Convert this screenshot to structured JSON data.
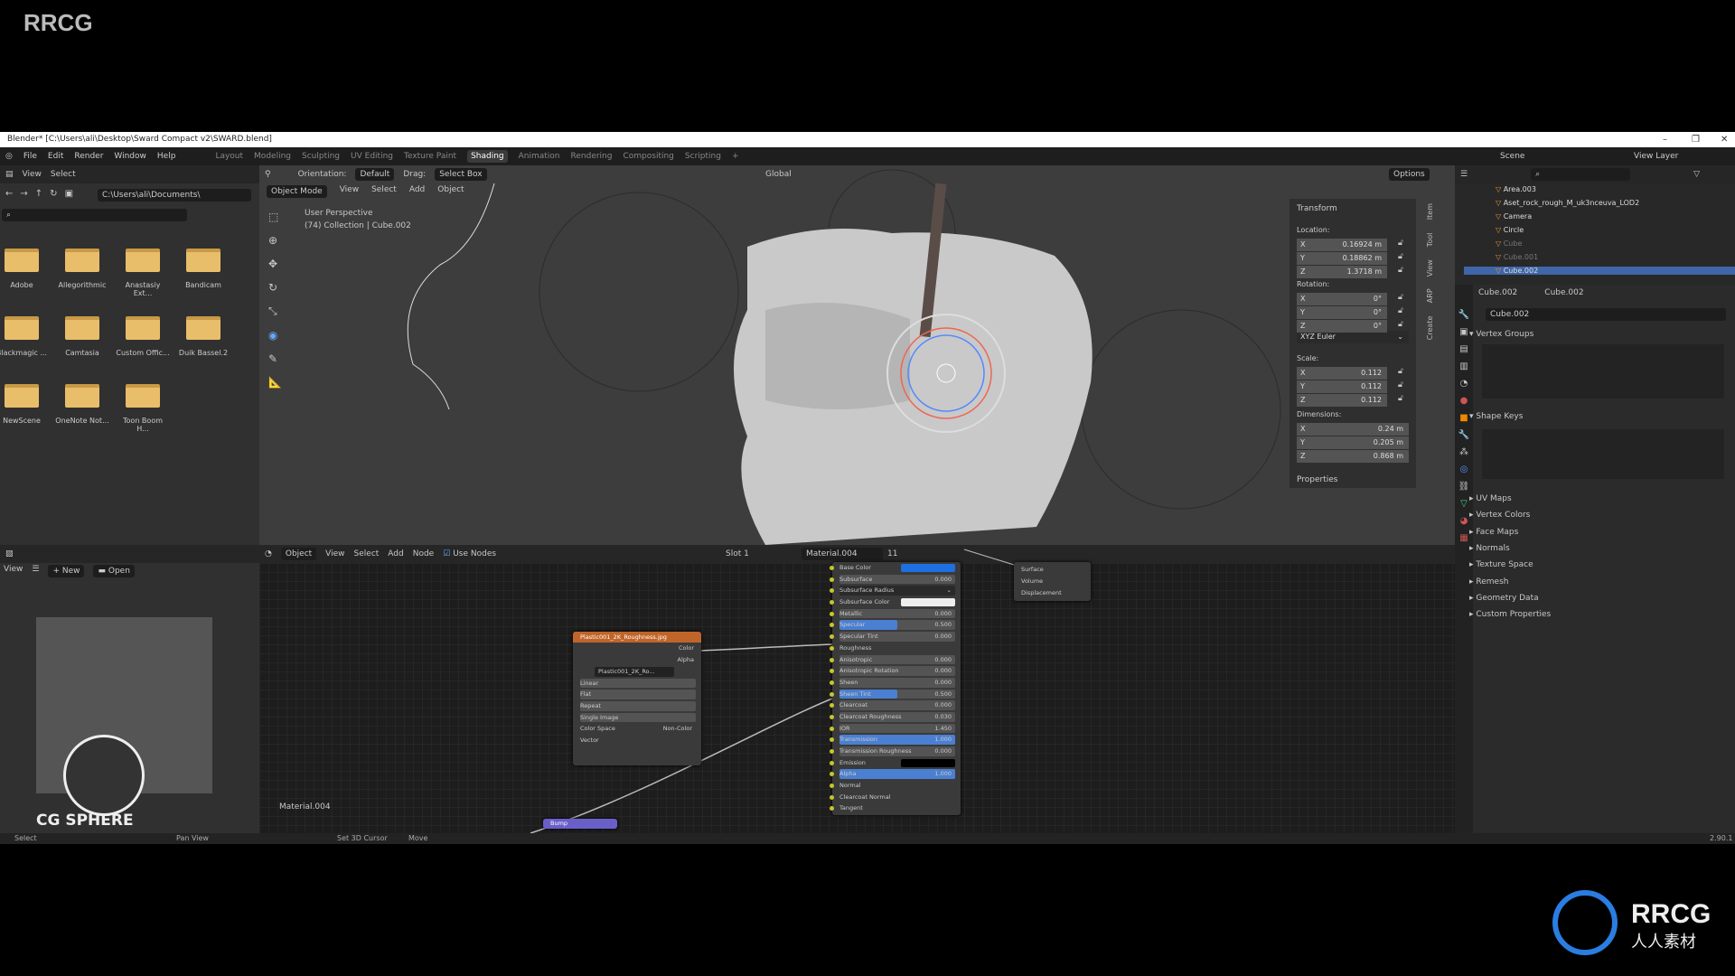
{
  "watermark": "RRCG",
  "window": {
    "title": "Blender* [C:\\Users\\ali\\Desktop\\Sward Compact v2\\SWARD.blend]",
    "min": "–",
    "max": "❐",
    "close": "✕"
  },
  "menu": [
    "File",
    "Edit",
    "Render",
    "Window",
    "Help"
  ],
  "workspaces": [
    {
      "label": "Layout"
    },
    {
      "label": "Modeling"
    },
    {
      "label": "Sculpting"
    },
    {
      "label": "UV Editing"
    },
    {
      "label": "Texture Paint"
    },
    {
      "label": "Shading",
      "active": true
    },
    {
      "label": "Animation"
    },
    {
      "label": "Rendering"
    },
    {
      "label": "Compositing"
    },
    {
      "label": "Scripting"
    },
    {
      "label": "+"
    }
  ],
  "scene": {
    "scene": "Scene",
    "view_layer": "View Layer"
  },
  "filebrowser": {
    "view": "View",
    "select": "Select",
    "path": "C:\\Users\\ali\\Documents\\",
    "folders": [
      "Adobe",
      "Allegorithmic",
      "Anastasiy Ext...",
      "Bandicam",
      "Blackmagic ...",
      "Camtasia",
      "Custom Offic...",
      "Duik Bassel.2",
      "NewScene",
      "OneNote Not...",
      "Toon Boom H..."
    ]
  },
  "viewport": {
    "orientation_label": "Orientation:",
    "orientation": "Default",
    "drag_label": "Drag:",
    "drag": "Select Box",
    "transform_space": "Global",
    "options": "Options",
    "mode": "Object Mode",
    "menus": [
      "View",
      "Select",
      "Add",
      "Object"
    ],
    "info1": "User Perspective",
    "info2": "(74) Collection | Cube.002"
  },
  "npanel": {
    "tabs": [
      "Item",
      "Tool",
      "View",
      "ARP",
      "Create"
    ],
    "title": "Transform",
    "location_label": "Location:",
    "location": [
      "0.16924 m",
      "0.18862 m",
      "1.3718 m"
    ],
    "rotation_label": "Rotation:",
    "rotation": [
      "0°",
      "0°",
      "0°"
    ],
    "rotation_mode": "XYZ Euler",
    "scale_label": "Scale:",
    "scale": [
      "0.112",
      "0.112",
      "0.112"
    ],
    "dimensions_label": "Dimensions:",
    "dimensions": [
      "0.24 m",
      "0.205 m",
      "0.868 m"
    ],
    "axes": [
      "X",
      "Y",
      "Z"
    ],
    "properties": "Properties"
  },
  "outliner": {
    "items": [
      {
        "name": "Area.003"
      },
      {
        "name": "Aset_rock_rough_M_uk3nceuva_LOD2"
      },
      {
        "name": "Camera"
      },
      {
        "name": "Circle"
      },
      {
        "name": "Cube",
        "dim": true
      },
      {
        "name": "Cube.001",
        "dim": true
      },
      {
        "name": "Cube.002",
        "selected": true
      }
    ]
  },
  "properties": {
    "object": "Cube.002",
    "mesh": "Cube.002",
    "mesh_field": "Cube.002",
    "vertex_groups": "Vertex Groups",
    "shape_keys": "Shape Keys",
    "sections": [
      "UV Maps",
      "Vertex Colors",
      "Face Maps",
      "Normals",
      "Texture Space",
      "Remesh",
      "Geometry Data",
      "Custom Properties"
    ]
  },
  "image_editor": {
    "view": "View",
    "new": "New",
    "open": "Open",
    "logo": "CG SPHERE"
  },
  "node_editor": {
    "type": "Object",
    "menus": [
      "View",
      "Select",
      "Add",
      "Node"
    ],
    "use_nodes": "Use Nodes",
    "slot": "Slot 1",
    "material": "Material.004",
    "users": "11",
    "material_label": "Material.004"
  },
  "image_node": {
    "title": "Plastic001_2K_Roughness.jpg",
    "outputs": [
      "Color",
      "Alpha"
    ],
    "image": "Plastic001_2K_Ro...",
    "interp": "Linear",
    "proj": "Flat",
    "ext": "Repeat",
    "source": "Single Image",
    "cs_label": "Color Space",
    "cs": "Non-Color",
    "input": "Vector"
  },
  "bsdf_node": {
    "rows": [
      {
        "label": "Base Color",
        "color": "#1e6fe0"
      },
      {
        "label": "Subsurface",
        "value": "0.000"
      },
      {
        "label": "Subsurface Radius",
        "value": "⌄"
      },
      {
        "label": "Subsurface Color",
        "color": "#eeeeee"
      },
      {
        "label": "Metallic",
        "value": "0.000"
      },
      {
        "label": "Specular",
        "value": "0.500",
        "fill": 0.5
      },
      {
        "label": "Specular Tint",
        "value": "0.000"
      },
      {
        "label": "Roughness"
      },
      {
        "label": "Anisotropic",
        "value": "0.000"
      },
      {
        "label": "Anisotropic Rotation",
        "value": "0.000"
      },
      {
        "label": "Sheen",
        "value": "0.000"
      },
      {
        "label": "Sheen Tint",
        "value": "0.500",
        "fill": 0.5
      },
      {
        "label": "Clearcoat",
        "value": "0.000"
      },
      {
        "label": "Clearcoat Roughness",
        "value": "0.030"
      },
      {
        "label": "IOR",
        "value": "1.450"
      },
      {
        "label": "Transmission",
        "value": "1.000",
        "fill": 1
      },
      {
        "label": "Transmission Roughness",
        "value": "0.000"
      },
      {
        "label": "Emission",
        "color": "#000000"
      },
      {
        "label": "Alpha",
        "value": "1.000",
        "fill": 1
      },
      {
        "label": "Normal"
      },
      {
        "label": "Clearcoat Normal"
      },
      {
        "label": "Tangent"
      }
    ]
  },
  "output_node": {
    "inputs": [
      "Surface",
      "Volume",
      "Displacement"
    ]
  },
  "bump_node": {
    "title": "Bump"
  },
  "status": {
    "select": "Select",
    "pan": "Pan View",
    "cursor": "Set 3D Cursor",
    "move": "Move",
    "version": "2.90.1"
  },
  "corner_logo": {
    "big": "RRCG",
    "small": "人人素材"
  }
}
